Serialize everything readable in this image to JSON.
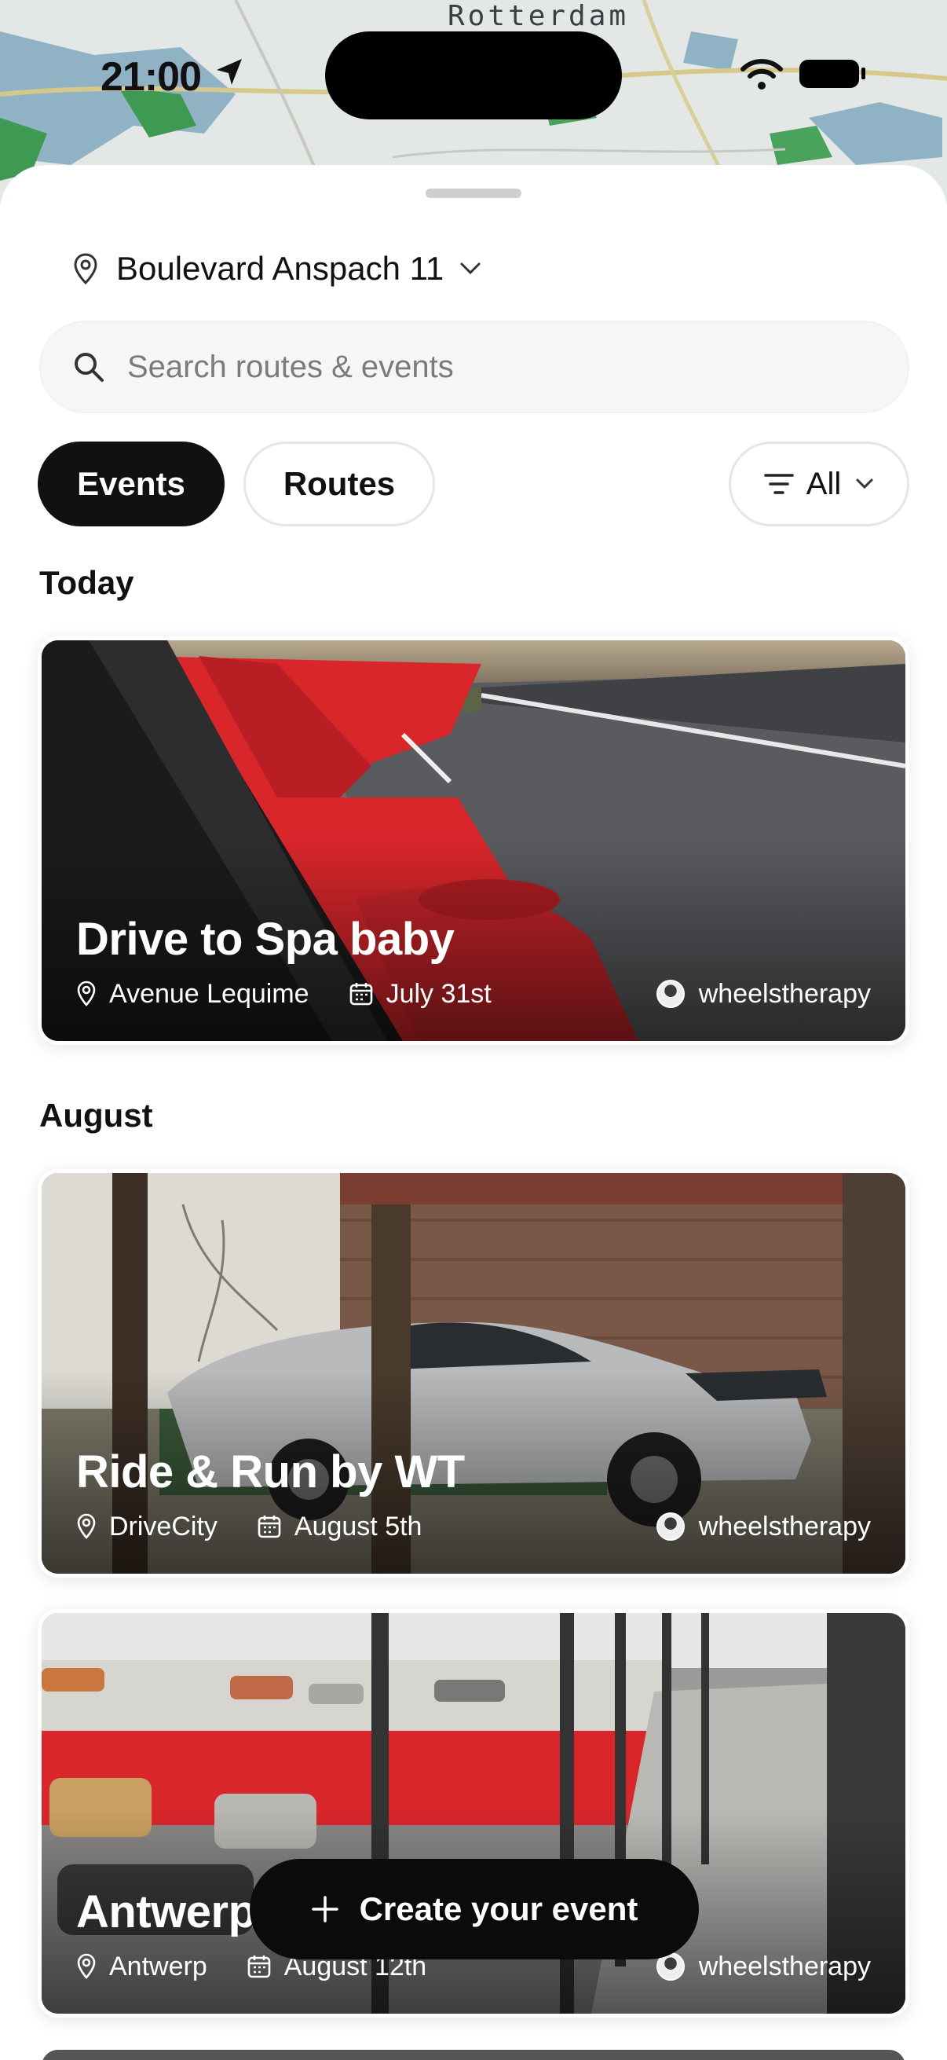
{
  "map": {
    "label": "Rotterdam"
  },
  "status_bar": {
    "time": "21:00"
  },
  "header": {
    "location": "Boulevard Anspach 11",
    "search_placeholder": "Search routes & events"
  },
  "tabs": [
    {
      "label": "Events",
      "active": true
    },
    {
      "label": "Routes",
      "active": false
    }
  ],
  "filter": {
    "label": "All"
  },
  "sections": [
    {
      "title": "Today",
      "events": [
        {
          "title": "Drive to Spa baby",
          "location": "Avenue Lequime",
          "date": "July 31st",
          "author": "wheelstherapy"
        }
      ]
    },
    {
      "title": "August",
      "events": [
        {
          "title": "Ride & Run by WT",
          "location": "DriveCity",
          "date": "August 5th",
          "author": "wheelstherapy"
        },
        {
          "title": "Antwerp",
          "location": "Antwerp",
          "date": "August 12th",
          "author": "wheelstherapy"
        }
      ]
    }
  ],
  "fab": {
    "label": "Create your event"
  },
  "colors": {
    "primary": "#111111",
    "accent_red": "#d9262b",
    "map_water": "#8fb3c4",
    "map_green": "#3e9a52"
  }
}
